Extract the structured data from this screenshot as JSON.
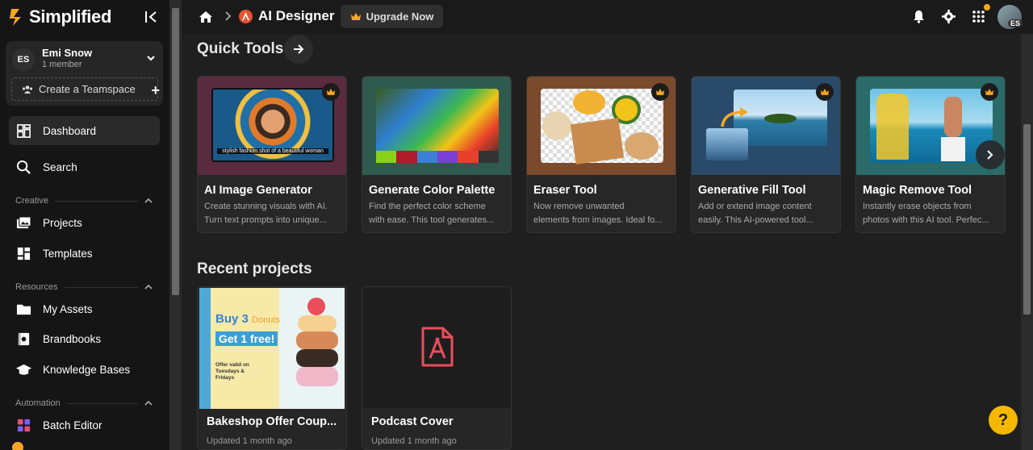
{
  "brand": {
    "name": "Simplified",
    "accent": "#f5a623"
  },
  "workspace": {
    "initials": "ES",
    "name": "Emi Snow",
    "members": "1 member",
    "create_label": "Create a Teamspace"
  },
  "nav": {
    "dashboard": "Dashboard",
    "search": "Search",
    "creative_header": "Creative",
    "projects": "Projects",
    "templates": "Templates",
    "resources_header": "Resources",
    "my_assets": "My Assets",
    "brandbooks": "Brandbooks",
    "knowledge_bases": "Knowledge Bases",
    "automation_header": "Automation",
    "batch_editor": "Batch Editor"
  },
  "topbar": {
    "app_title": "AI Designer",
    "upgrade_label": "Upgrade Now",
    "avatar_initials": "ES"
  },
  "quick_tools": {
    "title": "Quick Tools",
    "image_caption": "stylish fashion shot of a beautiful woman",
    "items": [
      {
        "name": "AI Image Generator",
        "desc1": "Create stunning visuals with AI.",
        "desc2": "Turn text prompts into unique..."
      },
      {
        "name": "Generate Color Palette",
        "desc1": "Find the perfect color scheme",
        "desc2": "with ease. This tool generates..."
      },
      {
        "name": "Eraser Tool",
        "desc1": "Now remove unwanted",
        "desc2": "elements from images. Ideal fo..."
      },
      {
        "name": "Generative Fill Tool",
        "desc1": "Add or extend image content",
        "desc2": "easily. This AI-powered tool..."
      },
      {
        "name": "Magic Remove Tool",
        "desc1": "Instantly erase objects from",
        "desc2": "photos with this AI tool. Perfec..."
      }
    ]
  },
  "recent": {
    "title": "Recent projects",
    "items": [
      {
        "name": "Bakeshop Offer Coup...",
        "meta": "Updated 1 month ago",
        "promo_line1": "Buy 3",
        "promo_line1b": "Donuts",
        "promo_line2": "Get 1 free!",
        "promo_note": "Offer valid on Tuesdays & Fridays"
      },
      {
        "name": "Podcast Cover",
        "meta": "Updated 1 month ago"
      }
    ]
  },
  "help_label": "?"
}
